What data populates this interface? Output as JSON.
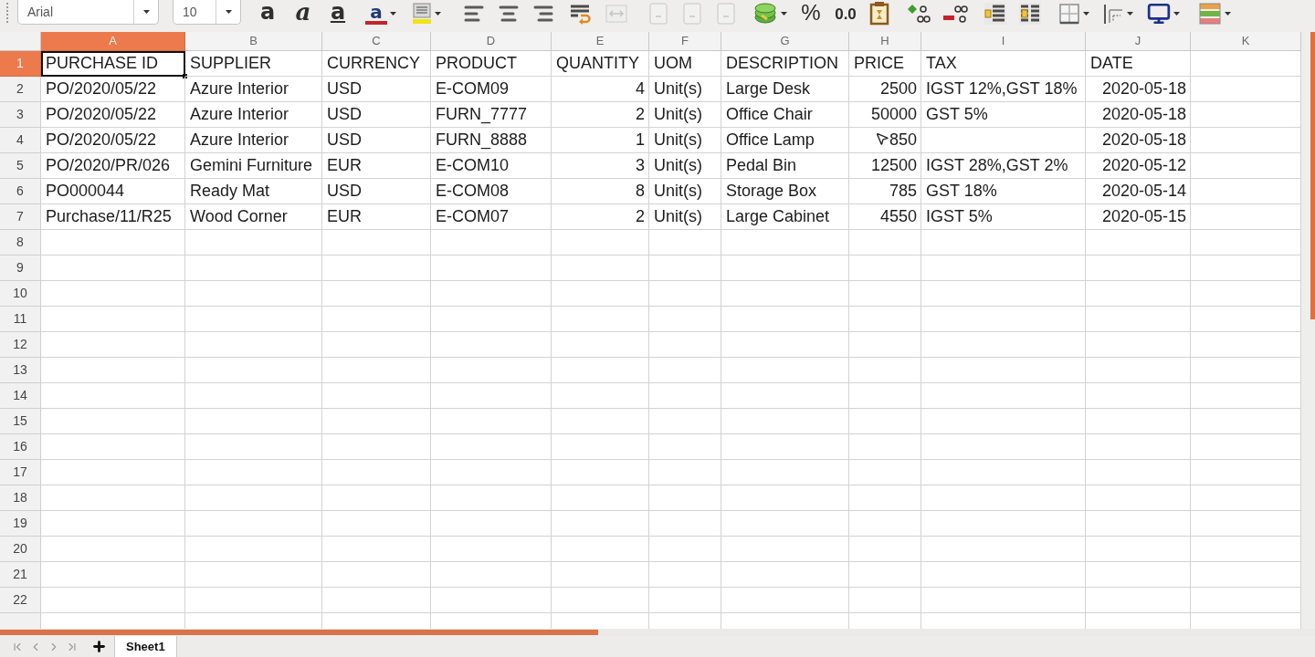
{
  "toolbar": {
    "items": [
      {
        "kind": "font_name",
        "value": "Arial",
        "disabled": false
      },
      {
        "kind": "font_size",
        "value": "10",
        "disabled": false
      },
      {
        "kind": "bold",
        "label": "a",
        "disabled": false
      },
      {
        "kind": "italic",
        "label": "a",
        "disabled": false
      },
      {
        "kind": "underline",
        "label": "a",
        "disabled": false
      },
      {
        "kind": "font_color",
        "label": "a",
        "disabled": false
      },
      {
        "kind": "highlight",
        "disabled": false
      },
      {
        "kind": "align_left",
        "disabled": false
      },
      {
        "kind": "align_center",
        "disabled": false
      },
      {
        "kind": "align_right",
        "disabled": false
      },
      {
        "kind": "wrap",
        "disabled": false
      },
      {
        "kind": "merge",
        "disabled": true
      },
      {
        "kind": "blank",
        "disabled": true
      },
      {
        "kind": "blank",
        "disabled": true
      },
      {
        "kind": "blank",
        "disabled": true
      },
      {
        "kind": "currency",
        "disabled": false
      },
      {
        "kind": "percent",
        "label": "%",
        "disabled": false
      },
      {
        "kind": "decimal",
        "label": "0.0",
        "disabled": false
      },
      {
        "kind": "date",
        "disabled": false
      },
      {
        "kind": "add_decimal",
        "disabled": false
      },
      {
        "kind": "delete_decimal",
        "disabled": false
      },
      {
        "kind": "indent_less",
        "disabled": false
      },
      {
        "kind": "indent_more",
        "disabled": false
      },
      {
        "kind": "borders",
        "disabled": false
      },
      {
        "kind": "border_style",
        "disabled": false
      },
      {
        "kind": "border_color",
        "disabled": false
      },
      {
        "kind": "conditional",
        "disabled": false
      }
    ]
  },
  "columns": [
    {
      "letter": "A",
      "selected": true
    },
    {
      "letter": "B",
      "selected": false
    },
    {
      "letter": "C",
      "selected": false
    },
    {
      "letter": "D",
      "selected": false
    },
    {
      "letter": "E",
      "selected": false
    },
    {
      "letter": "F",
      "selected": false
    },
    {
      "letter": "G",
      "selected": false
    },
    {
      "letter": "H",
      "selected": false
    },
    {
      "letter": "I",
      "selected": false
    },
    {
      "letter": "J",
      "selected": false
    },
    {
      "letter": "K",
      "selected": false
    }
  ],
  "rows": [
    {
      "number": "1",
      "selected": true,
      "cells": [
        {
          "value": "PURCHASE ID",
          "kind": "text"
        },
        {
          "value": "SUPPLIER",
          "kind": "text"
        },
        {
          "value": "CURRENCY",
          "kind": "text"
        },
        {
          "value": "PRODUCT",
          "kind": "text"
        },
        {
          "value": "QUANTITY",
          "kind": "text"
        },
        {
          "value": "UOM",
          "kind": "text"
        },
        {
          "value": "DESCRIPTION",
          "kind": "text"
        },
        {
          "value": "PRICE",
          "kind": "text"
        },
        {
          "value": "TAX",
          "kind": "text"
        },
        {
          "value": "DATE",
          "kind": "text"
        }
      ]
    },
    {
      "number": "2",
      "selected": false,
      "cells": [
        {
          "value": "PO/2020/05/22",
          "kind": "text"
        },
        {
          "value": "Azure Interior",
          "kind": "text"
        },
        {
          "value": "USD",
          "kind": "text"
        },
        {
          "value": "E-COM09",
          "kind": "text"
        },
        {
          "value": "4",
          "kind": "number"
        },
        {
          "value": "Unit(s)",
          "kind": "text"
        },
        {
          "value": "Large Desk",
          "kind": "text"
        },
        {
          "value": "2500",
          "kind": "number"
        },
        {
          "value": "IGST 12%,GST 18%",
          "kind": "text"
        },
        {
          "value": "2020-05-18",
          "kind": "number"
        }
      ]
    },
    {
      "number": "3",
      "selected": false,
      "cells": [
        {
          "value": "PO/2020/05/22",
          "kind": "text"
        },
        {
          "value": "Azure Interior",
          "kind": "text"
        },
        {
          "value": "USD",
          "kind": "text"
        },
        {
          "value": "FURN_7777",
          "kind": "text"
        },
        {
          "value": "2",
          "kind": "number"
        },
        {
          "value": "Unit(s)",
          "kind": "text"
        },
        {
          "value": "Office Chair",
          "kind": "text"
        },
        {
          "value": "50000",
          "kind": "number"
        },
        {
          "value": "GST 5%",
          "kind": "text"
        },
        {
          "value": "2020-05-18",
          "kind": "number"
        }
      ]
    },
    {
      "number": "4",
      "selected": false,
      "cells": [
        {
          "value": "PO/2020/05/22",
          "kind": "text"
        },
        {
          "value": "Azure Interior",
          "kind": "text"
        },
        {
          "value": "USD",
          "kind": "text"
        },
        {
          "value": "FURN_8888",
          "kind": "text"
        },
        {
          "value": "1",
          "kind": "number"
        },
        {
          "value": "Unit(s)",
          "kind": "text"
        },
        {
          "value": "Office Lamp",
          "kind": "text"
        },
        {
          "value": "850",
          "kind": "number"
        },
        {
          "kind": "blank"
        },
        {
          "value": "2020-05-18",
          "kind": "number"
        }
      ]
    },
    {
      "number": "5",
      "selected": false,
      "cells": [
        {
          "value": "PO/2020/PR/026",
          "kind": "text"
        },
        {
          "value": "Gemini Furniture",
          "kind": "text"
        },
        {
          "value": "EUR",
          "kind": "text"
        },
        {
          "value": "E-COM10",
          "kind": "text"
        },
        {
          "value": "3",
          "kind": "number"
        },
        {
          "value": "Unit(s)",
          "kind": "text"
        },
        {
          "value": "Pedal Bin",
          "kind": "text"
        },
        {
          "value": "12500",
          "kind": "number"
        },
        {
          "value": "IGST 28%,GST 2%",
          "kind": "text"
        },
        {
          "value": "2020-05-12",
          "kind": "number"
        }
      ]
    },
    {
      "number": "6",
      "selected": false,
      "cells": [
        {
          "value": "PO000044",
          "kind": "text"
        },
        {
          "value": "Ready Mat",
          "kind": "text"
        },
        {
          "value": "USD",
          "kind": "text"
        },
        {
          "value": "E-COM08",
          "kind": "text"
        },
        {
          "value": "8",
          "kind": "number"
        },
        {
          "value": "Unit(s)",
          "kind": "text"
        },
        {
          "value": "Storage Box",
          "kind": "text"
        },
        {
          "value": "785",
          "kind": "number"
        },
        {
          "value": "GST 18%",
          "kind": "text"
        },
        {
          "value": "2020-05-14",
          "kind": "number"
        }
      ]
    },
    {
      "number": "7",
      "selected": false,
      "cells": [
        {
          "value": "Purchase/11/R25",
          "kind": "text"
        },
        {
          "value": "Wood Corner",
          "kind": "text"
        },
        {
          "value": "EUR",
          "kind": "text"
        },
        {
          "value": "E-COM07",
          "kind": "text"
        },
        {
          "value": "2",
          "kind": "number"
        },
        {
          "value": "Unit(s)",
          "kind": "text"
        },
        {
          "value": "Large Cabinet",
          "kind": "text"
        },
        {
          "value": "4550",
          "kind": "number"
        },
        {
          "value": "IGST 5%",
          "kind": "text"
        },
        {
          "value": "2020-05-15",
          "kind": "number"
        }
      ]
    },
    {
      "number": "8",
      "selected": false
    },
    {
      "number": "9",
      "selected": false
    },
    {
      "number": "10",
      "selected": false
    },
    {
      "number": "11",
      "selected": false
    },
    {
      "number": "12",
      "selected": false
    },
    {
      "number": "13",
      "selected": false
    },
    {
      "number": "14",
      "selected": false
    },
    {
      "number": "15",
      "selected": false
    },
    {
      "number": "16",
      "selected": false
    },
    {
      "number": "17",
      "selected": false
    },
    {
      "number": "18",
      "selected": false
    },
    {
      "number": "19",
      "selected": false
    },
    {
      "number": "20",
      "selected": false
    },
    {
      "number": "21",
      "selected": false
    },
    {
      "number": "22",
      "selected": false
    }
  ],
  "sheet_tabs": [
    {
      "name": "Sheet1",
      "selected": true
    }
  ]
}
